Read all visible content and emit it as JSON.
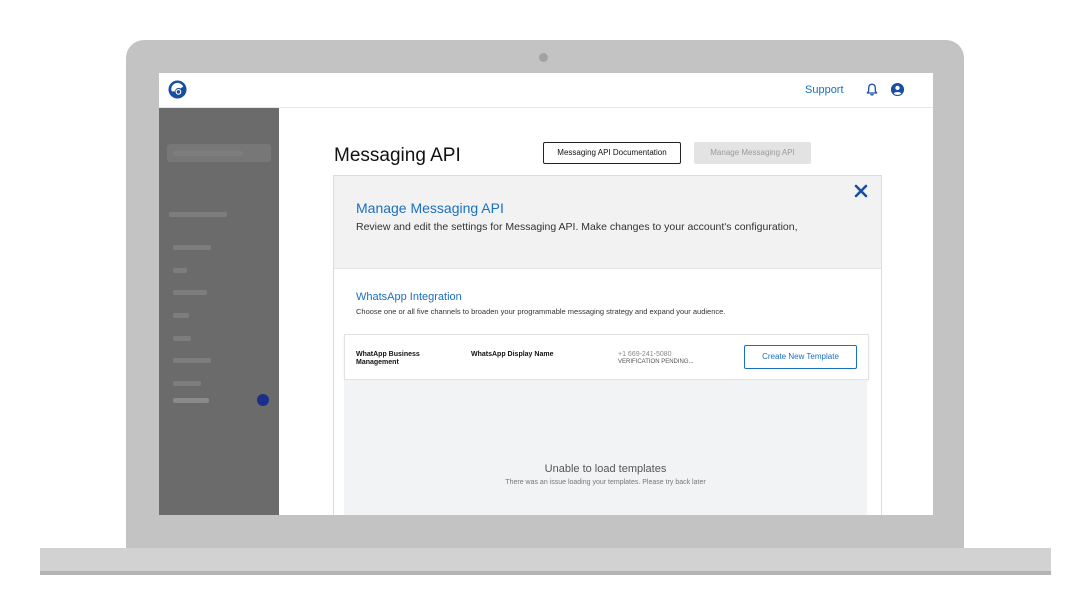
{
  "header": {
    "support_label": "Support",
    "icons": [
      "brand-logo-icon",
      "bell-icon",
      "user-icon"
    ],
    "accent_color": "#1a6fbf"
  },
  "sidebar": {
    "state": "blurred-placeholder",
    "background_color": "#6b6b6b",
    "badge_color": "#1a2f8a"
  },
  "page": {
    "title": "Messaging API",
    "doc_button_label": "Messaging API Documentation",
    "manage_button_label": "Manage Messaging API"
  },
  "panel": {
    "title": "Manage Messaging API",
    "description": "Review and edit the settings for Messaging API. Make changes to your account's configuration,",
    "close_icon": "close-icon",
    "whatsapp": {
      "title": "WhatsApp Integration",
      "description": "Choose one or all five channels to broaden your programmable messaging strategy and expand your audience.",
      "row": {
        "business_management": "WhatApp Business Management",
        "display_name": "WhatsApp Display Name",
        "phone": "+1 669-241-5080",
        "status": "VERIFICATION PENDING...",
        "create_button_label": "Create New Template"
      }
    },
    "templates": {
      "error_title": "Unable to load templates",
      "error_description": "There was an issue loading your templates.  Please try back later"
    }
  }
}
